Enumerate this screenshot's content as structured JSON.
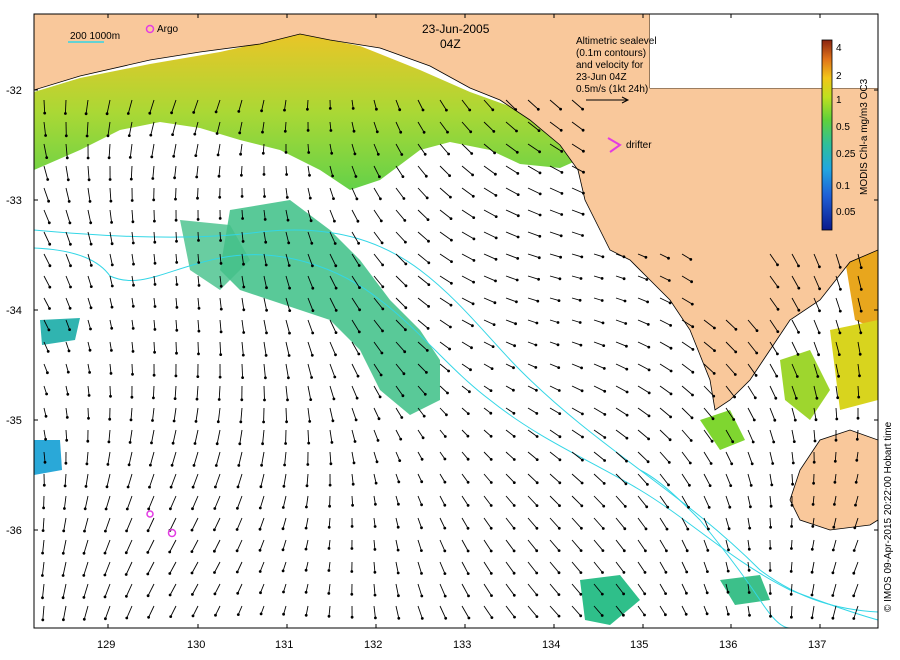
{
  "map": {
    "date": "23-Jun-2005",
    "time": "04Z",
    "scale_label": "200 1000m",
    "argo_label": "Argo",
    "drifter_label": "drifter",
    "velocity_text": [
      "Altimetric sealevel",
      "(0.1m contours)",
      "and velocity for",
      "23-Jun 04Z",
      "0.5m/s (1kt 24h)"
    ],
    "credit": "© IMOS 09-Apr-2015 20:22:00 Hobart time",
    "colorbar_title": "MODIS Chl-a mg/m3 OC3",
    "colorbar_ticks": [
      "4",
      "2",
      "1",
      "0.5",
      "0.25",
      "0.1",
      "0.05"
    ],
    "lon_ticks": [
      "129",
      "130",
      "131",
      "132",
      "133",
      "134",
      "135",
      "136",
      "137"
    ],
    "lat_ticks": [
      "-32",
      "-33",
      "-34",
      "-35",
      "-36"
    ],
    "colors": {
      "land": "#f9c89b",
      "contour": "#33d6e6",
      "argo": "#e33be3",
      "arrow": "#000000"
    }
  }
}
